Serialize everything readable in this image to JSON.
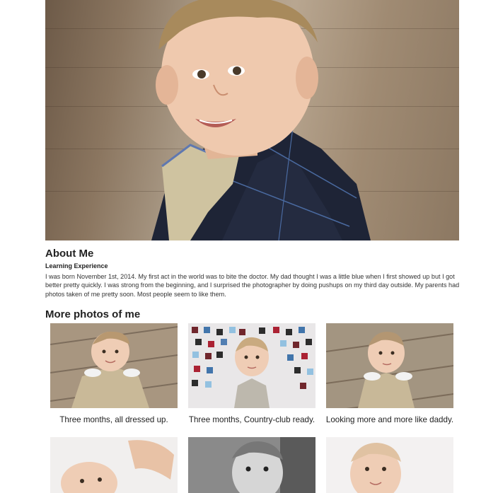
{
  "hero": {
    "icon": "baby-portrait-photo"
  },
  "about": {
    "heading": "About Me",
    "subheading": "Learning Experience",
    "body": "I was born November 1st, 2014. My first act in the world was to bite the doctor. My dad thought I was a little blue when I first showed up but I got better pretty quickly. I was strong from the beginning, and I surprised the photographer by doing pushups on my third day outside. My parents had photos taken of me pretty soon. Most people seem to like them."
  },
  "gallery": {
    "heading": "More photos of me",
    "items": [
      {
        "caption": "Three months, all dressed up."
      },
      {
        "caption": "Three months, Country-club ready."
      },
      {
        "caption": "Looking more and more like daddy."
      }
    ]
  }
}
